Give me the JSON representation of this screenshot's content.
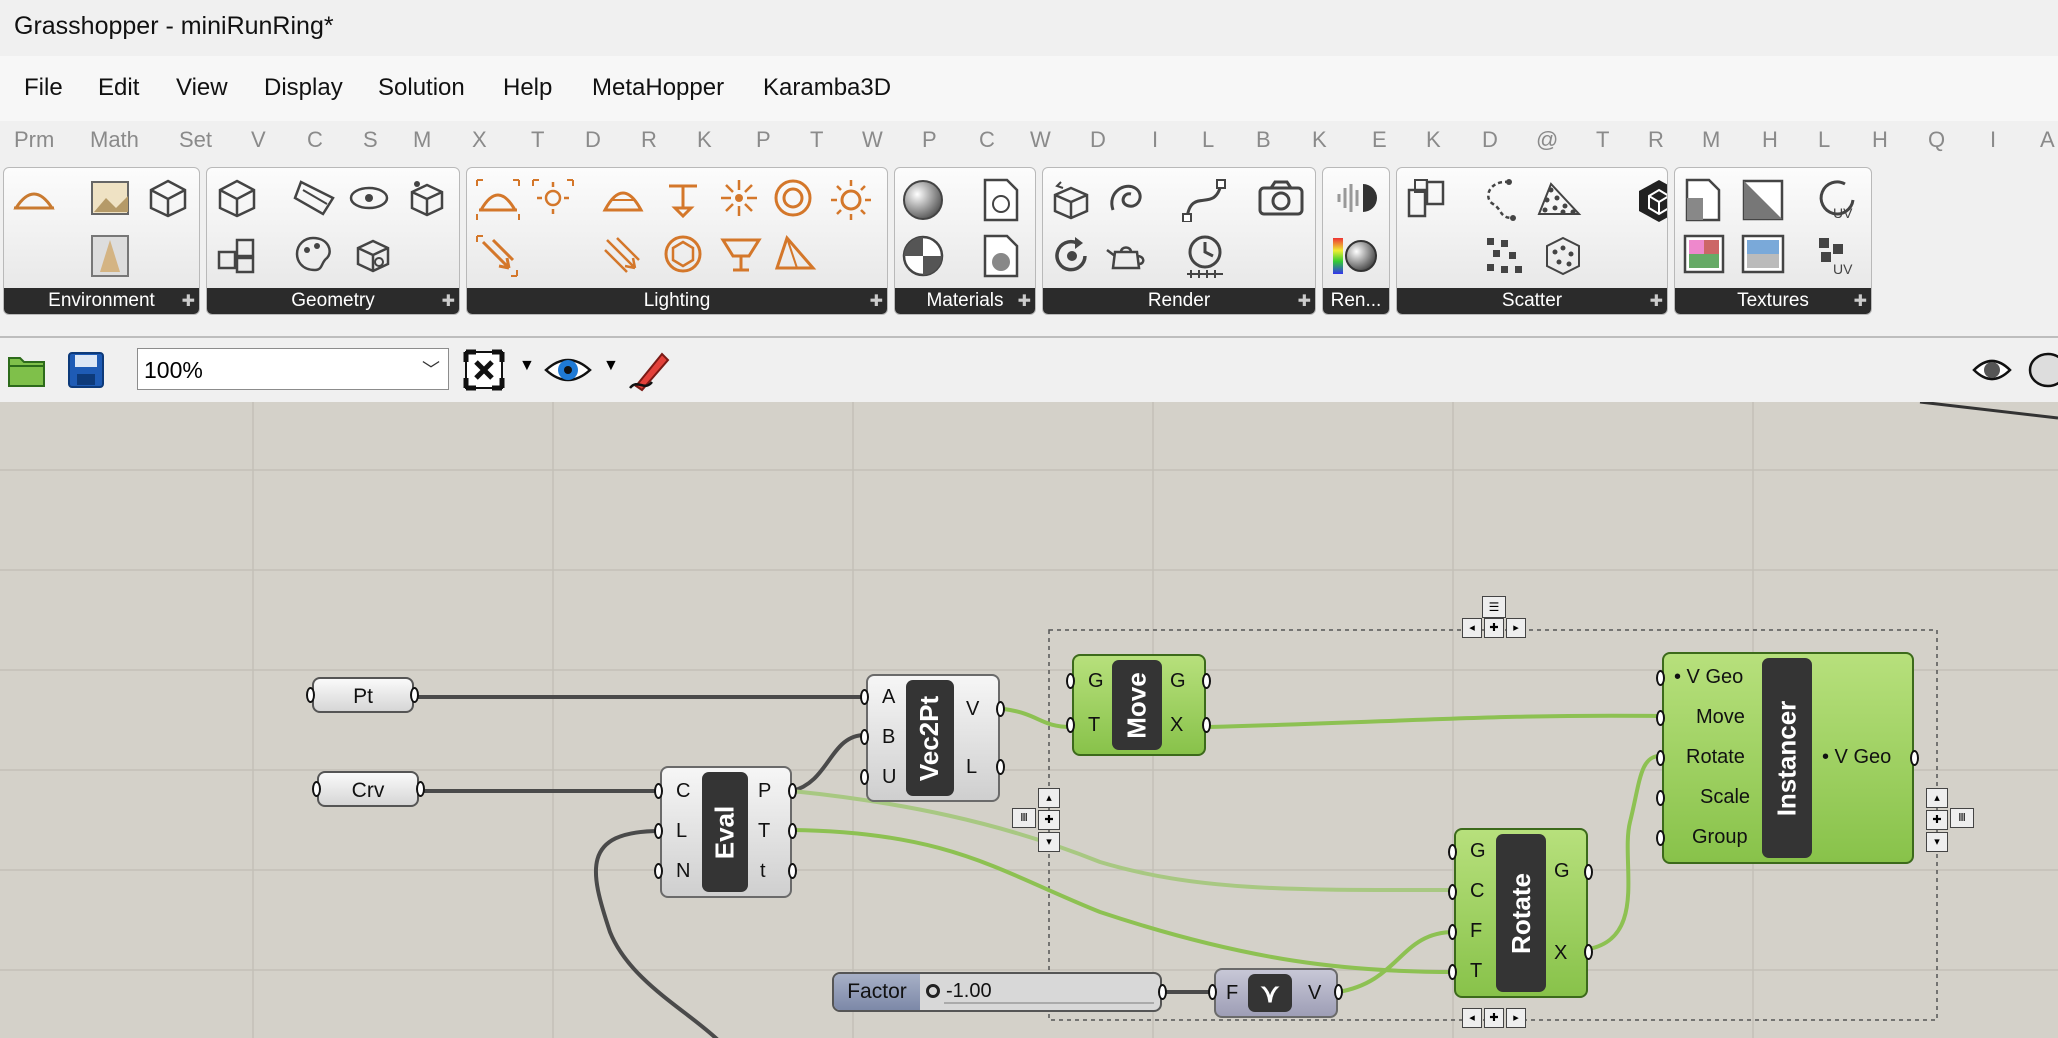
{
  "window": {
    "title": "Grasshopper - miniRunRing*"
  },
  "menu": [
    "File",
    "Edit",
    "View",
    "Display",
    "Solution",
    "Help",
    "MetaHopper",
    "Karamba3D"
  ],
  "tabs": [
    "Prm",
    "Math",
    "Set",
    "V",
    "C",
    "S",
    "M",
    "X",
    "T",
    "D",
    "R",
    "K",
    "P",
    "T",
    "W",
    "P",
    "C",
    "W",
    "D",
    "I",
    "L",
    "B",
    "K",
    "E",
    "K",
    "D",
    "@",
    "T",
    "R",
    "M",
    "H",
    "L",
    "H",
    "Q",
    "I",
    "A"
  ],
  "ribbon_panels": [
    "Environment",
    "Geometry",
    "Lighting",
    "Materials",
    "Render",
    "Ren...",
    "Scatter",
    "Textures"
  ],
  "toolbar": {
    "zoom": "100%"
  },
  "components": {
    "pt": {
      "label": "Pt"
    },
    "crv": {
      "label": "Crv"
    },
    "eval": {
      "name": "Eval",
      "inputs": [
        "C",
        "L",
        "N"
      ],
      "outputs": [
        "P",
        "T",
        "t"
      ]
    },
    "vec2pt": {
      "name": "Vec2Pt",
      "inputs": [
        "A",
        "B",
        "U"
      ],
      "outputs": [
        "V",
        "L"
      ]
    },
    "move": {
      "name": "Move",
      "inputs": [
        "G",
        "T"
      ],
      "outputs": [
        "G",
        "X"
      ]
    },
    "rotate": {
      "name": "Rotate",
      "inputs": [
        "G",
        "C",
        "F",
        "T"
      ],
      "outputs": [
        "G",
        "X"
      ]
    },
    "instancer": {
      "name": "Instancer",
      "inputs": [
        "• V Geo",
        "Move",
        "Rotate",
        "Scale",
        "Group"
      ],
      "outputs": [
        "• V Geo"
      ]
    },
    "negative": {
      "inputs": [
        "F"
      ],
      "outputs": [
        "V"
      ]
    },
    "slider": {
      "label": "Factor",
      "value": "-1.00"
    }
  },
  "colors": {
    "wire_green": "#8dc152",
    "wire_dark": "#4a4a4a",
    "component_green": "#9dd05c",
    "canvas_bg": "#d4d1c9"
  }
}
